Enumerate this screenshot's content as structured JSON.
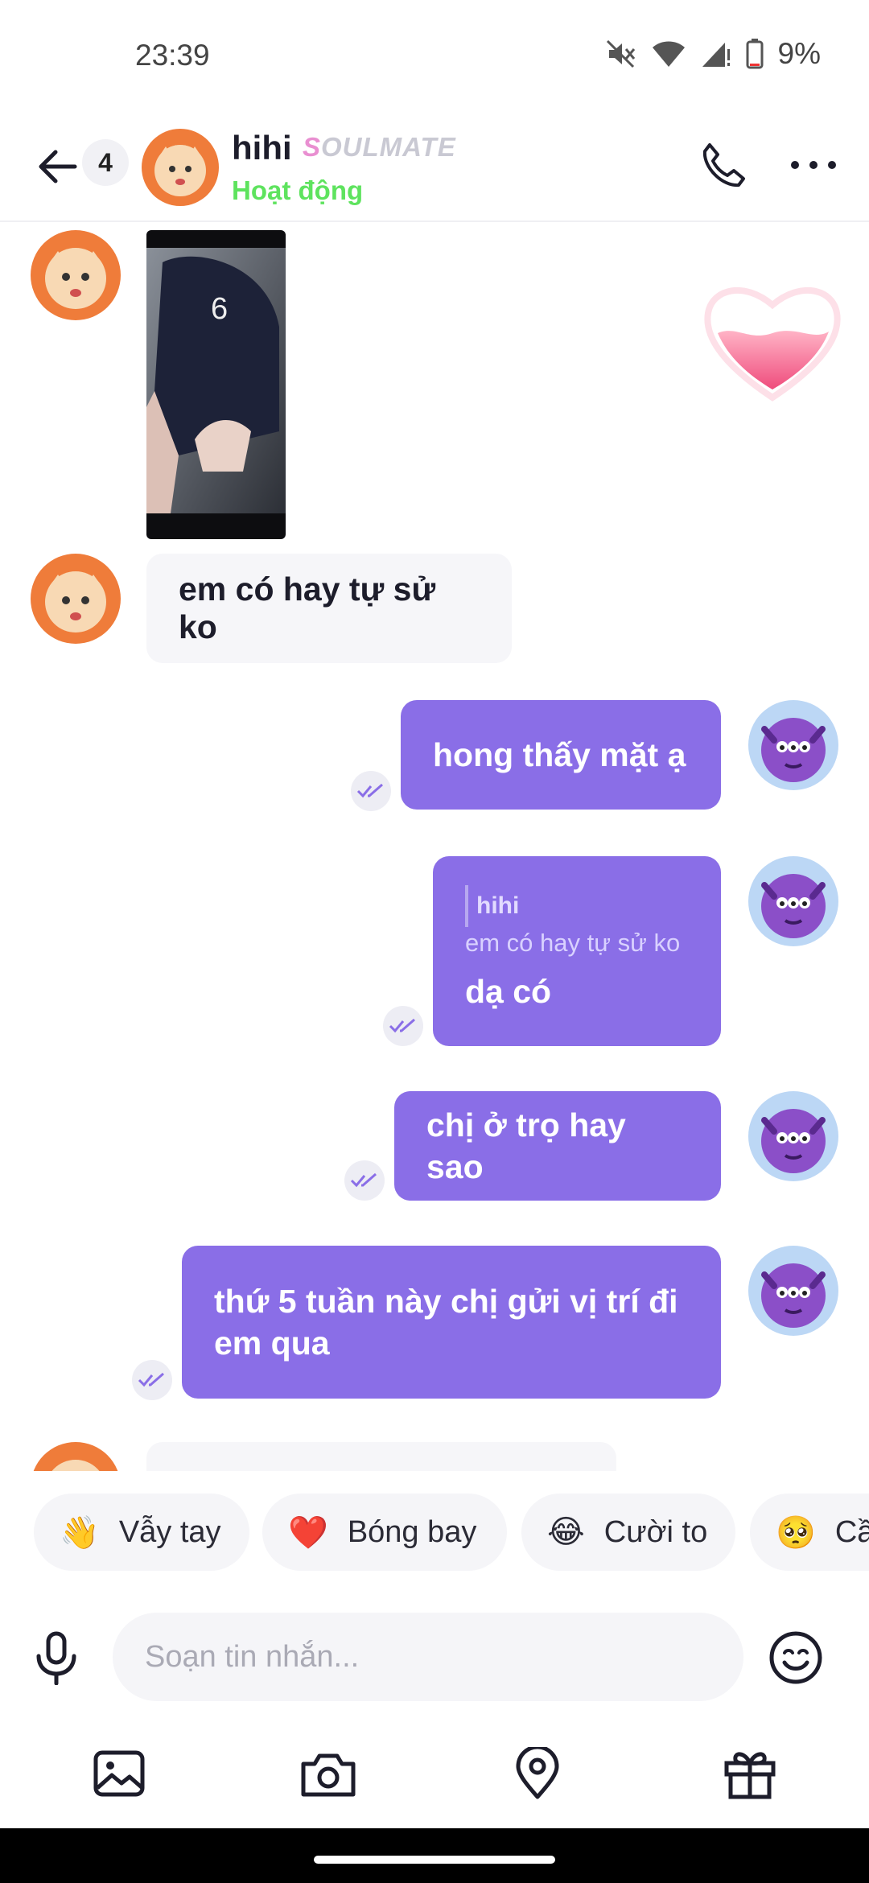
{
  "status_bar": {
    "time": "23:39",
    "battery": "9%"
  },
  "header": {
    "unread_count": "4",
    "contact_name": "hihi",
    "tag_label": "SOULMATE",
    "status": "Hoạt động"
  },
  "messages": {
    "incoming_1": "em có hay tự sử ko",
    "outgoing_1": "hong thấy mặt ạ",
    "reply_quote_name": "hihi",
    "reply_quote_text": "em có hay tự sử ko",
    "outgoing_2": "dạ có",
    "outgoing_3": "chị ở trọ hay sao",
    "outgoing_4": "thứ 5 tuần này chị gửi vị trí đi em qua"
  },
  "quick_reactions": [
    {
      "emoji": "👋",
      "label": "Vẫy tay"
    },
    {
      "emoji": "❤️",
      "label": "Bóng bay"
    },
    {
      "emoji": "😂",
      "label": "Cười to"
    },
    {
      "emoji": "🥺",
      "label": "Cầ"
    }
  ],
  "composer": {
    "placeholder": "Soạn tin nhắn..."
  },
  "colors": {
    "accent": "#8a6ee7",
    "online": "#5ee35e",
    "incoming_bubble": "#f6f6f9"
  },
  "icons": [
    "back-arrow-icon",
    "phone-icon",
    "more-icon",
    "mic-icon",
    "emoji-icon",
    "gallery-icon",
    "camera-icon",
    "location-icon",
    "gift-icon",
    "read-check-icon",
    "heart-icon"
  ]
}
